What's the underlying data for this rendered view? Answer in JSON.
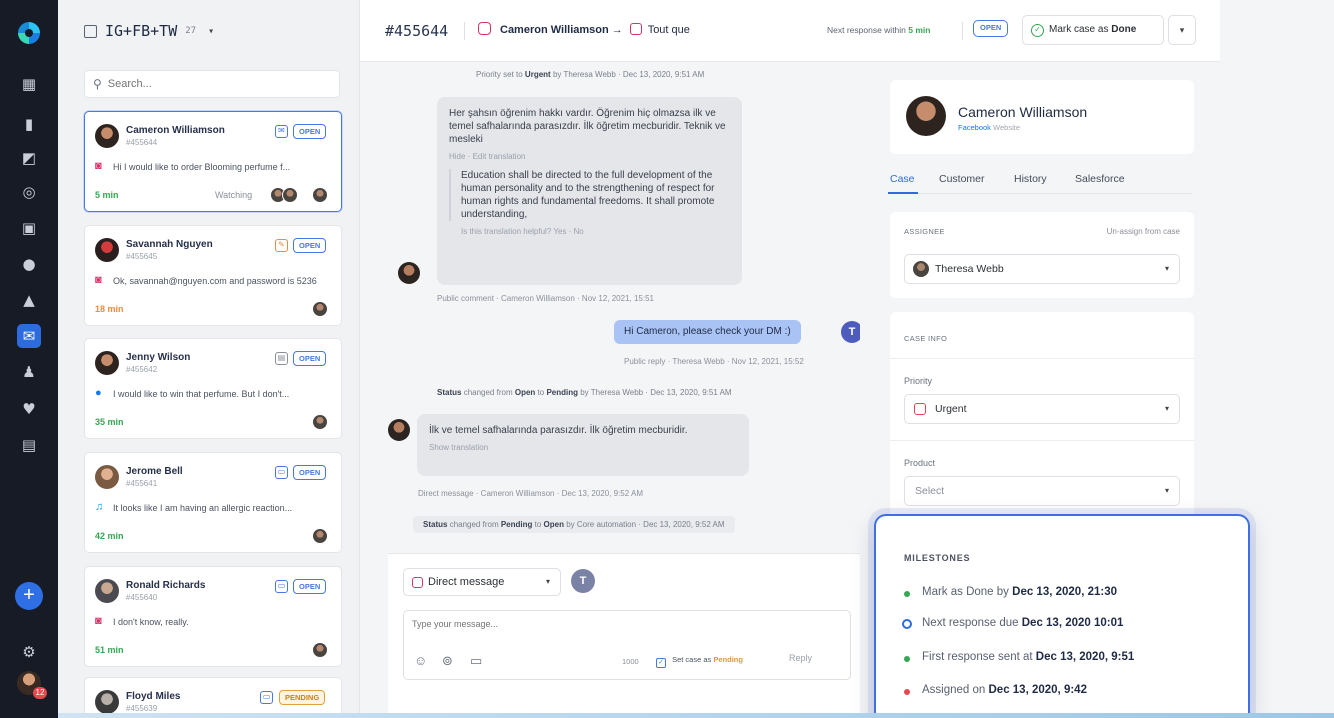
{
  "inbox": {
    "title": "IG+FB+TW",
    "count": "27",
    "search_placeholder": "Search..."
  },
  "conversations": [
    {
      "name": "Cameron Williamson",
      "case_no": "#455644",
      "status": "OPEN",
      "channel": "instagram",
      "message": "Hi I would like to order Blooming perfume f...",
      "time": "5 min",
      "watching": "Watching"
    },
    {
      "name": "Savannah Nguyen",
      "case_no": "#455645",
      "status": "OPEN",
      "channel": "instagram",
      "message": "Ok, savannah@nguyen.com and password is 5236",
      "time": "18 min"
    },
    {
      "name": "Jenny Wilson",
      "case_no": "#455642",
      "status": "OPEN",
      "channel": "facebook",
      "message": "I would like to win that perfume. But I don't...",
      "time": "35 min"
    },
    {
      "name": "Jerome Bell",
      "case_no": "#455641",
      "status": "OPEN",
      "channel": "twitter",
      "message": "It looks like I am having an allergic reaction...",
      "time": "42 min"
    },
    {
      "name": "Ronald Richards",
      "case_no": "#455640",
      "status": "OPEN",
      "channel": "instagram",
      "message": "I don't know, really.",
      "time": "51 min"
    },
    {
      "name": "Floyd Miles",
      "case_no": "#455639",
      "status": "PENDING",
      "channel": "instagram",
      "message": "",
      "time": ""
    }
  ],
  "header": {
    "case_id": "#455644",
    "customer": "Cameron Williamson",
    "arrow": "→",
    "page": "Tout que",
    "next_response_prefix": "Next response within",
    "next_response_time": "5 min",
    "status": "OPEN",
    "done_prefix": "Mark case as",
    "done_word": "Done",
    "more": "▾"
  },
  "thread": {
    "sys1_prefix": "Priority set to",
    "sys1_bold": "Urgent",
    "sys1_suffix": "by Theresa Webb · Dec 13, 2020, 9:51 AM",
    "msg1_text": "Her şahsın öğrenim hakkı vardır. Öğrenim hiç olmazsa ilk ve temel safhalarında parasızdır. İlk öğretim mecburidir. Teknik ve mesleki",
    "msg1_links": "Hide · Edit translation",
    "msg1_translation": "Education shall be directed to the full development of the human personality and to the strengthening of respect for human rights and fundamental freedoms. It shall promote understanding,",
    "msg1_feedback": "Is this translation helpful? Yes · No",
    "msg1_meta": "Public comment · Cameron Williamson · Nov 12, 2021, 15:51",
    "out_text": "Hi Cameron, please check your DM :)",
    "out_avatar": "T",
    "out_meta": "Public reply · Theresa Webb · Nov 12, 2021, 15:52",
    "sys2_prefix": "Status",
    "sys2_mid1": "changed from",
    "sys2_from": "Open",
    "sys2_mid2": "to",
    "sys2_to": "Pending",
    "sys2_suffix": "by Theresa Webb · Dec 13, 2020, 9:51 AM",
    "msg2_text": "İlk ve temel safhalarında parasızdır. İlk öğretim mecburidir.",
    "msg2_link": "Show translation",
    "msg2_meta": "Direct message · Cameron Williamson · Dec 13, 2020, 9:52 AM",
    "sys3_prefix": "Status",
    "sys3_mid1": "changed from",
    "sys3_from": "Pending",
    "sys3_mid2": "to",
    "sys3_to": "Open",
    "sys3_suffix": "by Core automation · Dec 13, 2020, 9:52 AM"
  },
  "composer": {
    "channel": "Direct message",
    "avatar": "T",
    "placeholder": "Type your message...",
    "chars": "1000",
    "set_case_as": "Set case as",
    "set_status": "Pending",
    "reply": "Reply"
  },
  "contact": {
    "name": "Cameron Williamson",
    "source": "Facebook",
    "source_suffix": "Website"
  },
  "tabs": [
    "Case",
    "Customer",
    "History",
    "Salesforce"
  ],
  "assignee": {
    "label": "ASSIGNEE",
    "unassign": "Un-assign from case",
    "value": "Theresa Webb"
  },
  "case_info": {
    "label": "CASE INFO",
    "priority_label": "Priority",
    "priority_value": "Urgent",
    "product_label": "Product",
    "product_value": "Select"
  },
  "milestones": {
    "title": "MILESTONES",
    "items": [
      {
        "text": "Mark as Done by",
        "bold": "Dec 13, 2020, 21:30"
      },
      {
        "text": "Next response due",
        "bold": "Dec 13, 2020 10:01"
      },
      {
        "text": "First response sent at",
        "bold": "Dec 13, 2020, 9:51"
      },
      {
        "text": "Assigned on",
        "bold": "Dec 13, 2020, 9:42"
      }
    ]
  },
  "rail": {
    "badge": "12"
  },
  "colors": {
    "accent": "#2d6cdf",
    "open": "#4a78e0",
    "pending": "#e0a23b",
    "success": "#34a853"
  }
}
